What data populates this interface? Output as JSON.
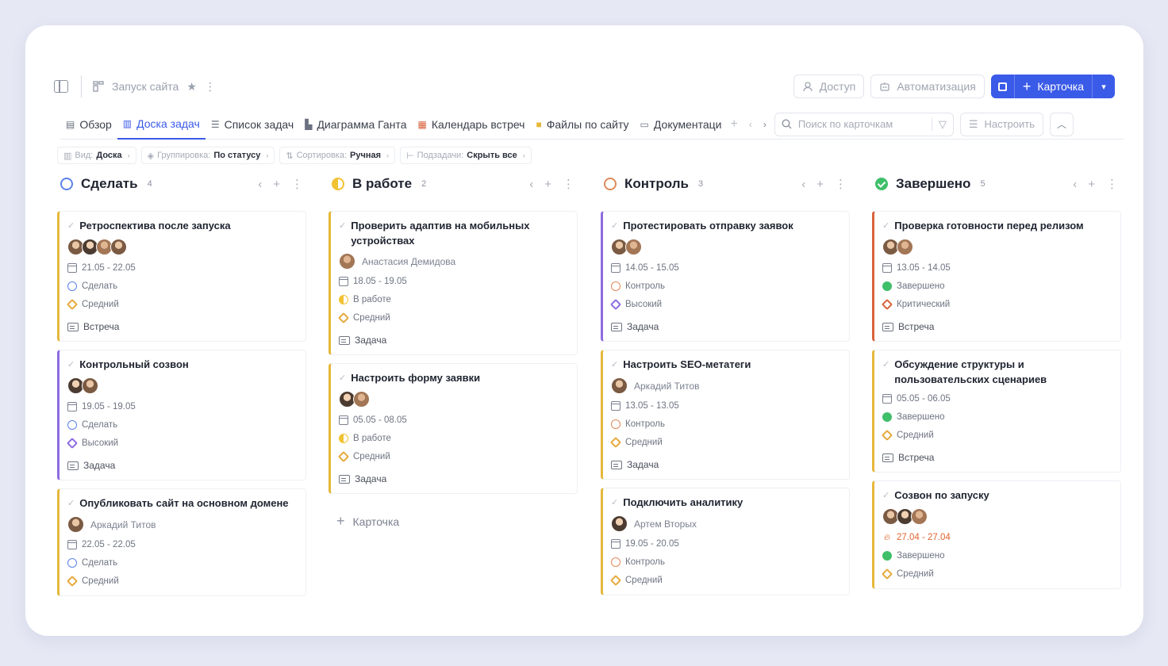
{
  "header": {
    "breadcrumb": "Запуск сайта",
    "access_label": "Доступ",
    "automation_label": "Автоматизация",
    "create_label": "Карточка"
  },
  "tabs": [
    {
      "label": "Обзор",
      "icon": "document-icon"
    },
    {
      "label": "Доска задач",
      "icon": "board-icon",
      "active": true
    },
    {
      "label": "Список задач",
      "icon": "list-icon"
    },
    {
      "label": "Диаграмма Ганта",
      "icon": "gantt-icon"
    },
    {
      "label": "Календарь встреч",
      "icon": "calendar-icon"
    },
    {
      "label": "Файлы по сайту",
      "icon": "folder-icon"
    },
    {
      "label": "Документаци",
      "icon": "chat-icon"
    }
  ],
  "search": {
    "placeholder": "Поиск по карточкам"
  },
  "configure_label": "Настроить",
  "filters": [
    {
      "key": "Вид:",
      "value": "Доска"
    },
    {
      "key": "Группировка:",
      "value": "По статусу"
    },
    {
      "key": "Сортировка:",
      "value": "Ручная"
    },
    {
      "key": "Подзадачи:",
      "value": "Скрыть все"
    }
  ],
  "columns": [
    {
      "title": "Сделать",
      "count": "4",
      "cards": [
        {
          "title": "Ретроспектива после запуска",
          "dates": "21.05 - 22.05",
          "status": "Сделать",
          "priority": "Средний",
          "type": "Встреча"
        },
        {
          "title": "Контрольный созвон",
          "dates": "19.05 - 19.05",
          "status": "Сделать",
          "priority": "Высокий",
          "type": "Задача"
        },
        {
          "title": "Опубликовать сайт на основном домене",
          "assignee": "Аркадий Титов",
          "dates": "22.05 - 22.05",
          "status": "Сделать",
          "priority": "Средний"
        }
      ]
    },
    {
      "title": "В работе",
      "count": "2",
      "add_label": "Карточка",
      "cards": [
        {
          "title": "Проверить адаптив на мобильных устройствах",
          "assignee": "Анастасия Демидова",
          "dates": "18.05 - 19.05",
          "status": "В работе",
          "priority": "Средний",
          "type": "Задача"
        },
        {
          "title": "Настроить форму заявки",
          "dates": "05.05 - 08.05",
          "status": "В работе",
          "priority": "Средний",
          "type": "Задача"
        }
      ]
    },
    {
      "title": "Контроль",
      "count": "3",
      "cards": [
        {
          "title": "Протестировать отправку заявок",
          "dates": "14.05 - 15.05",
          "status": "Контроль",
          "priority": "Высокий",
          "type": "Задача"
        },
        {
          "title": "Настроить SEO-метатеги",
          "assignee": "Аркадий Титов",
          "dates": "13.05 - 13.05",
          "status": "Контроль",
          "priority": "Средний",
          "type": "Задача"
        },
        {
          "title": "Подключить аналитику",
          "assignee": "Артем Вторых",
          "dates": "19.05 - 20.05",
          "status": "Контроль",
          "priority": "Средний"
        }
      ]
    },
    {
      "title": "Завершено",
      "count": "5",
      "cards": [
        {
          "title": "Проверка готовности перед релизом",
          "dates": "13.05 - 14.05",
          "status": "Завершено",
          "priority": "Критический",
          "type": "Встреча"
        },
        {
          "title": "Обсуждение структуры и пользовательских сценариев",
          "dates": "05.05 - 06.05",
          "status": "Завершено",
          "priority": "Средний",
          "type": "Встреча"
        },
        {
          "title": "Созвон по запуску",
          "dates": "27.04 - 27.04",
          "status": "Завершено",
          "priority": "Средний"
        }
      ]
    }
  ],
  "colors": {
    "accent": "#3a5ae8",
    "medium": "#e5b83b",
    "high": "#8e6be0",
    "critical": "#d9623c",
    "done": "#3fbf6a"
  }
}
